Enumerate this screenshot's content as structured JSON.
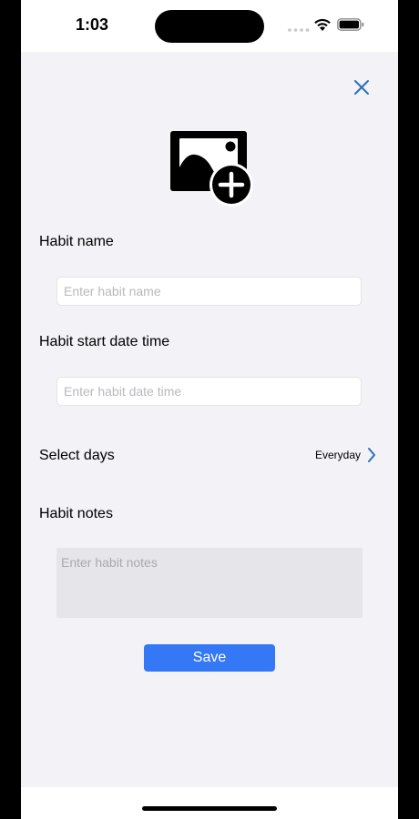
{
  "status_bar": {
    "time": "1:03"
  },
  "form": {
    "close_icon": "close-icon",
    "add_photo_icon": "add-photo-icon",
    "habit_name_label": "Habit name",
    "habit_name_placeholder": "Enter habit name",
    "habit_name_value": "",
    "start_label": "Habit start date time",
    "start_placeholder": "Enter habit date time",
    "start_value": "",
    "days_label": "Select days",
    "days_value": "Everyday",
    "notes_label": "Habit notes",
    "notes_placeholder": "Enter habit notes",
    "notes_value": "",
    "save_label": "Save"
  },
  "colors": {
    "accent": "#3478f6",
    "close_icon": "#2f6fb5",
    "background": "#f2f2f7",
    "notes_bg": "#e5e5ea"
  }
}
